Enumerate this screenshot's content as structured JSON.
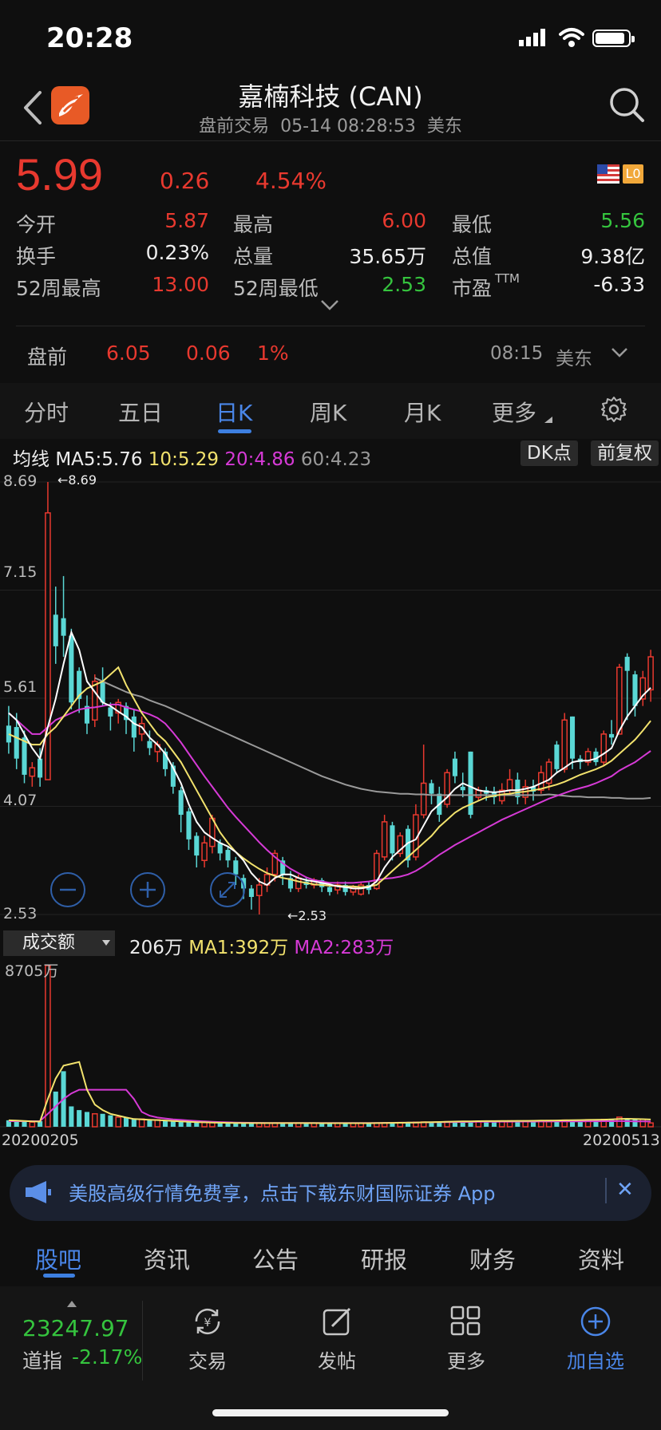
{
  "status": {
    "time": "20:28"
  },
  "header": {
    "title": "嘉楠科技 (CAN)",
    "subtitle": "盘前交易  05-14 08:28:53  美东"
  },
  "quote": {
    "price": "5.99",
    "change": "0.26",
    "change_pct": "4.54%",
    "level_badge": "L0",
    "stats": [
      {
        "label": "今开",
        "value": "5.87",
        "color": "red"
      },
      {
        "label": "最高",
        "value": "6.00",
        "color": "red"
      },
      {
        "label": "最低",
        "value": "5.56",
        "color": "green"
      },
      {
        "label": "换手",
        "value": "0.23%",
        "color": "white"
      },
      {
        "label": "总量",
        "value": "35.65万",
        "color": "white"
      },
      {
        "label": "总值",
        "value": "9.38亿",
        "color": "white"
      },
      {
        "label": "52周最高",
        "value": "13.00",
        "color": "red"
      },
      {
        "label": "52周最低",
        "value": "2.53",
        "color": "green"
      },
      {
        "label": "市盈",
        "value": "-6.33",
        "color": "white",
        "sup": "TTM"
      }
    ]
  },
  "premarket": {
    "label": "盘前",
    "price": "6.05",
    "change": "0.06",
    "change_pct": "1%",
    "time": "08:15",
    "tz": "美东"
  },
  "period_tabs": [
    {
      "label": "分时",
      "active": false
    },
    {
      "label": "五日",
      "active": false
    },
    {
      "label": "日K",
      "active": true
    },
    {
      "label": "周K",
      "active": false
    },
    {
      "label": "月K",
      "active": false
    },
    {
      "label": "更多",
      "active": false
    }
  ],
  "ma_row": {
    "prefix": "均线",
    "ma5": "MA5:5.76",
    "ma10": "10:5.29",
    "ma20": "20:4.86",
    "ma60": "60:4.23",
    "dk_button": "DK点",
    "adjust_button": "前复权"
  },
  "volume_row": {
    "selector": "成交额",
    "current": "206万",
    "ma1": "MA1:392万",
    "ma2": "MA2:283万"
  },
  "chart_data": [
    {
      "type": "candlestick",
      "y_ticks": [
        "8.69",
        "7.15",
        "5.61",
        "4.07",
        "2.53"
      ],
      "ylim": [
        2.53,
        8.69
      ],
      "high_marker": "8.69",
      "low_marker": "2.53",
      "colors": {
        "up": "#e8392f",
        "down": "#5ad7d5",
        "ma5": "#ffffff",
        "ma10": "#f2e26d",
        "ma20": "#d63ad6",
        "ma60": "#9a9a9a"
      },
      "candles": [
        {
          "o": 5.22,
          "c": 4.98,
          "h": 5.5,
          "l": 4.82
        },
        {
          "o": 5.2,
          "c": 4.75,
          "h": 5.4,
          "l": 4.6
        },
        {
          "o": 5.05,
          "c": 4.52,
          "h": 5.15,
          "l": 4.4
        },
        {
          "o": 4.5,
          "c": 4.62,
          "h": 4.7,
          "l": 4.35
        },
        {
          "o": 4.75,
          "c": 4.48,
          "h": 4.9,
          "l": 4.35
        },
        {
          "o": 4.45,
          "c": 8.25,
          "h": 8.69,
          "l": 4.45
        },
        {
          "o": 6.8,
          "c": 6.35,
          "h": 7.2,
          "l": 6.1
        },
        {
          "o": 6.75,
          "c": 6.5,
          "h": 7.35,
          "l": 6.2
        },
        {
          "o": 6.5,
          "c": 5.55,
          "h": 6.6,
          "l": 5.45
        },
        {
          "o": 6.0,
          "c": 5.6,
          "h": 6.05,
          "l": 5.4
        },
        {
          "o": 5.5,
          "c": 5.25,
          "h": 5.65,
          "l": 5.1
        },
        {
          "o": 5.3,
          "c": 5.85,
          "h": 5.95,
          "l": 5.2
        },
        {
          "o": 5.85,
          "c": 5.55,
          "h": 6.05,
          "l": 5.5
        },
        {
          "o": 5.48,
          "c": 5.35,
          "h": 5.55,
          "l": 5.15
        },
        {
          "o": 5.4,
          "c": 5.55,
          "h": 5.6,
          "l": 5.25
        },
        {
          "o": 5.5,
          "c": 5.3,
          "h": 5.55,
          "l": 5.1
        },
        {
          "o": 5.35,
          "c": 5.05,
          "h": 5.45,
          "l": 4.85
        },
        {
          "o": 5.1,
          "c": 5.25,
          "h": 5.35,
          "l": 5.0
        },
        {
          "o": 5.0,
          "c": 4.9,
          "h": 5.15,
          "l": 4.8
        },
        {
          "o": 4.85,
          "c": 4.95,
          "h": 5.0,
          "l": 4.7
        },
        {
          "o": 4.85,
          "c": 4.6,
          "h": 4.9,
          "l": 4.5
        },
        {
          "o": 4.65,
          "c": 4.35,
          "h": 4.7,
          "l": 4.25
        },
        {
          "o": 4.3,
          "c": 3.95,
          "h": 4.35,
          "l": 3.7
        },
        {
          "o": 4.0,
          "c": 3.6,
          "h": 4.05,
          "l": 3.45
        },
        {
          "o": 3.65,
          "c": 3.37,
          "h": 3.7,
          "l": 3.2
        },
        {
          "o": 3.3,
          "c": 3.55,
          "h": 3.65,
          "l": 3.2
        },
        {
          "o": 3.5,
          "c": 3.9,
          "h": 3.95,
          "l": 3.4
        },
        {
          "o": 3.55,
          "c": 3.4,
          "h": 3.6,
          "l": 3.3
        },
        {
          "o": 3.45,
          "c": 3.3,
          "h": 3.5,
          "l": 3.2
        },
        {
          "o": 3.3,
          "c": 3.1,
          "h": 3.35,
          "l": 2.95
        },
        {
          "o": 3.05,
          "c": 2.9,
          "h": 3.1,
          "l": 2.75
        },
        {
          "o": 2.9,
          "c": 2.78,
          "h": 2.95,
          "l": 2.6
        },
        {
          "o": 2.8,
          "c": 2.95,
          "h": 3.05,
          "l": 2.53
        },
        {
          "o": 2.95,
          "c": 3.1,
          "h": 3.2,
          "l": 2.85
        },
        {
          "o": 3.1,
          "c": 3.4,
          "h": 3.45,
          "l": 3.0
        },
        {
          "o": 3.3,
          "c": 3.1,
          "h": 3.35,
          "l": 2.95
        },
        {
          "o": 3.05,
          "c": 2.9,
          "h": 3.15,
          "l": 2.85
        },
        {
          "o": 2.9,
          "c": 3.05,
          "h": 3.1,
          "l": 2.85
        },
        {
          "o": 3.0,
          "c": 2.95,
          "h": 3.05,
          "l": 2.9
        },
        {
          "o": 2.95,
          "c": 3.02,
          "h": 3.05,
          "l": 2.9
        },
        {
          "o": 3.02,
          "c": 2.92,
          "h": 3.05,
          "l": 2.85
        },
        {
          "o": 2.92,
          "c": 2.85,
          "h": 2.95,
          "l": 2.8
        },
        {
          "o": 2.88,
          "c": 2.95,
          "h": 3.0,
          "l": 2.82
        },
        {
          "o": 2.95,
          "c": 2.85,
          "h": 3.0,
          "l": 2.8
        },
        {
          "o": 2.85,
          "c": 2.92,
          "h": 2.95,
          "l": 2.8
        },
        {
          "o": 2.82,
          "c": 2.95,
          "h": 3.0,
          "l": 2.8
        },
        {
          "o": 2.95,
          "c": 2.88,
          "h": 3.0,
          "l": 2.82
        },
        {
          "o": 2.9,
          "c": 3.4,
          "h": 3.45,
          "l": 2.88
        },
        {
          "o": 3.35,
          "c": 3.85,
          "h": 3.95,
          "l": 3.3
        },
        {
          "o": 3.8,
          "c": 3.4,
          "h": 3.85,
          "l": 3.3
        },
        {
          "o": 3.4,
          "c": 3.65,
          "h": 3.7,
          "l": 3.35
        },
        {
          "o": 3.75,
          "c": 3.3,
          "h": 3.8,
          "l": 3.2
        },
        {
          "o": 3.35,
          "c": 3.95,
          "h": 4.1,
          "l": 3.3
        },
        {
          "o": 3.95,
          "c": 4.4,
          "h": 4.95,
          "l": 3.9
        },
        {
          "o": 4.4,
          "c": 4.25,
          "h": 4.45,
          "l": 4.1
        },
        {
          "o": 4.25,
          "c": 3.95,
          "h": 4.35,
          "l": 3.85
        },
        {
          "o": 4.1,
          "c": 4.55,
          "h": 4.6,
          "l": 4.05
        },
        {
          "o": 4.75,
          "c": 4.5,
          "h": 4.85,
          "l": 4.4
        },
        {
          "o": 4.35,
          "c": 4.3,
          "h": 4.55,
          "l": 4.2
        },
        {
          "o": 4.85,
          "c": 3.95,
          "h": 4.85,
          "l": 3.9
        },
        {
          "o": 4.2,
          "c": 4.3,
          "h": 4.35,
          "l": 4.15
        },
        {
          "o": 4.3,
          "c": 4.25,
          "h": 4.35,
          "l": 4.15
        },
        {
          "o": 4.28,
          "c": 4.2,
          "h": 4.35,
          "l": 4.1
        },
        {
          "o": 4.15,
          "c": 4.3,
          "h": 4.4,
          "l": 4.1
        },
        {
          "o": 4.3,
          "c": 4.45,
          "h": 4.6,
          "l": 4.25
        },
        {
          "o": 4.45,
          "c": 4.2,
          "h": 4.55,
          "l": 4.1
        },
        {
          "o": 4.2,
          "c": 4.35,
          "h": 4.45,
          "l": 4.1
        },
        {
          "o": 4.35,
          "c": 4.28,
          "h": 4.45,
          "l": 4.15
        },
        {
          "o": 4.3,
          "c": 4.55,
          "h": 4.65,
          "l": 4.25
        },
        {
          "o": 4.4,
          "c": 4.7,
          "h": 4.75,
          "l": 4.3
        },
        {
          "o": 4.95,
          "c": 4.6,
          "h": 5.0,
          "l": 4.55
        },
        {
          "o": 4.6,
          "c": 5.3,
          "h": 5.4,
          "l": 4.55
        },
        {
          "o": 5.35,
          "c": 4.75,
          "h": 5.35,
          "l": 4.6
        },
        {
          "o": 4.75,
          "c": 4.7,
          "h": 4.8,
          "l": 4.6
        },
        {
          "o": 4.7,
          "c": 4.85,
          "h": 4.9,
          "l": 4.65
        },
        {
          "o": 4.85,
          "c": 4.7,
          "h": 4.9,
          "l": 4.65
        },
        {
          "o": 4.7,
          "c": 5.1,
          "h": 5.15,
          "l": 4.65
        },
        {
          "o": 5.1,
          "c": 5.05,
          "h": 5.3,
          "l": 4.95
        },
        {
          "o": 5.1,
          "c": 6.05,
          "h": 6.1,
          "l": 5.1
        },
        {
          "o": 6.2,
          "c": 6.0,
          "h": 6.25,
          "l": 5.3
        },
        {
          "o": 5.95,
          "c": 5.5,
          "h": 6.0,
          "l": 5.35
        },
        {
          "o": 5.6,
          "c": 5.9,
          "h": 6.0,
          "l": 5.5
        },
        {
          "o": 5.73,
          "c": 6.2,
          "h": 6.3,
          "l": 5.56
        }
      ],
      "ma5": [
        5.4,
        5.3,
        5.1,
        4.9,
        4.75,
        5.2,
        5.6,
        6.1,
        6.55,
        6.3,
        5.85,
        5.7,
        5.55,
        5.5,
        5.42,
        5.35,
        5.25,
        5.2,
        5.05,
        4.95,
        4.82,
        4.62,
        4.4,
        4.1,
        3.85,
        3.7,
        3.62,
        3.55,
        3.5,
        3.42,
        3.3,
        3.12,
        3.0,
        2.95,
        3.05,
        3.1,
        3.1,
        3.05,
        3.02,
        3.0,
        2.98,
        2.96,
        2.93,
        2.92,
        2.9,
        2.9,
        2.92,
        3.0,
        3.2,
        3.35,
        3.45,
        3.55,
        3.6,
        3.8,
        4.0,
        4.1,
        4.2,
        4.32,
        4.4,
        4.35,
        4.3,
        4.28,
        4.27,
        4.28,
        4.3,
        4.3,
        4.32,
        4.35,
        4.4,
        4.45,
        4.55,
        4.62,
        4.7,
        4.72,
        4.72,
        4.75,
        4.82,
        4.9,
        5.15,
        5.35,
        5.5,
        5.65,
        5.76
      ],
      "ma10": [
        5.1,
        5.05,
        5.0,
        4.95,
        4.95,
        5.1,
        5.2,
        5.35,
        5.5,
        5.65,
        5.75,
        5.8,
        5.85,
        5.95,
        6.05,
        5.8,
        5.6,
        5.4,
        5.25,
        5.1,
        5.0,
        4.85,
        4.7,
        4.5,
        4.3,
        4.1,
        3.9,
        3.7,
        3.55,
        3.42,
        3.33,
        3.25,
        3.18,
        3.12,
        3.08,
        3.05,
        3.03,
        3.0,
        2.98,
        2.96,
        2.95,
        2.94,
        2.94,
        2.93,
        2.93,
        2.92,
        2.93,
        2.95,
        3.05,
        3.15,
        3.25,
        3.35,
        3.45,
        3.55,
        3.65,
        3.78,
        3.88,
        3.98,
        4.05,
        4.1,
        4.15,
        4.2,
        4.22,
        4.24,
        4.25,
        4.27,
        4.28,
        4.3,
        4.32,
        4.35,
        4.38,
        4.42,
        4.47,
        4.52,
        4.56,
        4.6,
        4.65,
        4.72,
        4.82,
        4.92,
        5.02,
        5.15,
        5.29
      ],
      "ma20": [
        5.4,
        5.3,
        5.2,
        5.1,
        5.1,
        5.2,
        5.3,
        5.35,
        5.4,
        5.45,
        5.47,
        5.48,
        5.5,
        5.52,
        5.52,
        5.48,
        5.45,
        5.42,
        5.38,
        5.33,
        5.25,
        5.12,
        4.98,
        4.82,
        4.66,
        4.5,
        4.35,
        4.2,
        4.05,
        3.92,
        3.8,
        3.68,
        3.56,
        3.45,
        3.35,
        3.26,
        3.18,
        3.12,
        3.06,
        3.02,
        3.0,
        2.98,
        2.98,
        2.98,
        2.98,
        2.99,
        3.0,
        3.02,
        3.04,
        3.05,
        3.07,
        3.1,
        3.15,
        3.22,
        3.3,
        3.38,
        3.45,
        3.52,
        3.58,
        3.64,
        3.7,
        3.76,
        3.82,
        3.88,
        3.93,
        3.98,
        4.03,
        4.08,
        4.13,
        4.18,
        4.22,
        4.26,
        4.3,
        4.33,
        4.36,
        4.4,
        4.45,
        4.5,
        4.58,
        4.64,
        4.7,
        4.78,
        4.86
      ],
      "ma60": [
        null,
        null,
        null,
        null,
        null,
        null,
        null,
        null,
        null,
        null,
        null,
        5.9,
        5.85,
        5.8,
        5.75,
        5.7,
        5.66,
        5.63,
        5.58,
        5.54,
        5.5,
        5.45,
        5.4,
        5.35,
        5.3,
        5.25,
        5.2,
        5.15,
        5.1,
        5.05,
        5.0,
        4.95,
        4.9,
        4.85,
        4.8,
        4.75,
        4.7,
        4.65,
        4.6,
        4.55,
        4.5,
        4.46,
        4.42,
        4.38,
        4.35,
        4.32,
        4.3,
        4.28,
        4.27,
        4.26,
        4.25,
        4.25,
        4.24,
        4.24,
        4.23,
        4.23,
        4.23,
        4.23,
        4.23,
        4.23,
        4.23,
        4.23,
        4.23,
        4.23,
        4.23,
        4.23,
        4.23,
        4.23,
        4.23,
        4.24,
        4.23,
        4.22,
        4.21,
        4.21,
        4.2,
        4.2,
        4.2,
        4.19,
        4.19,
        4.18,
        4.18,
        4.18,
        4.19
      ]
    },
    {
      "type": "bar",
      "title": "成交额",
      "max_label": "8705万",
      "x_start": "20200205",
      "x_end": "20200513",
      "ylim": [
        0,
        8705
      ],
      "values": [
        350,
        300,
        280,
        250,
        300,
        8705,
        1900,
        3000,
        1100,
        900,
        800,
        700,
        700,
        620,
        520,
        500,
        430,
        420,
        400,
        380,
        360,
        300,
        280,
        260,
        240,
        230,
        220,
        210,
        200,
        200,
        200,
        200,
        200,
        200,
        210,
        200,
        200,
        200,
        190,
        200,
        190,
        190,
        190,
        190,
        200,
        190,
        200,
        210,
        220,
        230,
        230,
        240,
        250,
        260,
        270,
        280,
        280,
        290,
        300,
        300,
        310,
        310,
        310,
        310,
        320,
        320,
        320,
        330,
        330,
        340,
        350,
        360,
        360,
        370,
        380,
        390,
        400,
        420,
        520,
        460,
        420,
        400,
        206
      ],
      "ma1": [
        350,
        330,
        310,
        290,
        280,
        1500,
        2600,
        3300,
        3400,
        3500,
        2000,
        1200,
        900,
        700,
        600,
        500,
        420,
        400,
        380,
        360,
        340,
        310,
        290,
        270,
        250,
        240,
        230,
        220,
        210,
        205,
        200,
        200,
        200,
        200,
        200,
        200,
        200,
        200,
        198,
        198,
        196,
        195,
        195,
        195,
        195,
        195,
        196,
        198,
        205,
        210,
        215,
        222,
        230,
        240,
        250,
        260,
        270,
        280,
        288,
        292,
        300,
        305,
        308,
        310,
        315,
        318,
        320,
        325,
        330,
        335,
        342,
        350,
        355,
        362,
        370,
        378,
        385,
        395,
        420,
        430,
        420,
        410,
        392
      ],
      "ma2": [
        300,
        300,
        300,
        300,
        300,
        700,
        1100,
        1500,
        1800,
        2000,
        2000,
        2000,
        2000,
        2000,
        2000,
        2000,
        1500,
        800,
        600,
        500,
        450,
        400,
        370,
        340,
        310,
        290,
        270,
        255,
        240,
        230,
        220,
        215,
        210,
        205,
        205,
        205,
        205,
        205,
        205,
        205,
        205,
        205,
        205,
        205,
        205,
        205,
        205,
        205,
        210,
        215,
        220,
        225,
        230,
        235,
        240,
        245,
        250,
        255,
        260,
        265,
        268,
        270,
        272,
        274,
        276,
        278,
        280,
        282,
        284,
        286,
        288,
        290,
        292,
        294,
        296,
        298,
        300,
        302,
        304,
        300,
        295,
        290,
        283
      ]
    }
  ],
  "promo": {
    "text": "美股高级行情免费享，点击下载东财国际证券 App",
    "close": "✕"
  },
  "section_tabs": [
    {
      "label": "股吧",
      "active": true
    },
    {
      "label": "资讯",
      "active": false
    },
    {
      "label": "公告",
      "active": false
    },
    {
      "label": "研报",
      "active": false
    },
    {
      "label": "财务",
      "active": false
    },
    {
      "label": "资料",
      "active": false
    }
  ],
  "bottom_bar": {
    "index_value": "23247.97",
    "index_name": "道指",
    "index_pct": "-2.17%",
    "nav": [
      {
        "label": "交易",
        "icon": "yen-exchange-icon"
      },
      {
        "label": "发帖",
        "icon": "compose-icon"
      },
      {
        "label": "更多",
        "icon": "grid-icon"
      },
      {
        "label": "加自选",
        "icon": "add-watchlist-icon"
      }
    ]
  }
}
